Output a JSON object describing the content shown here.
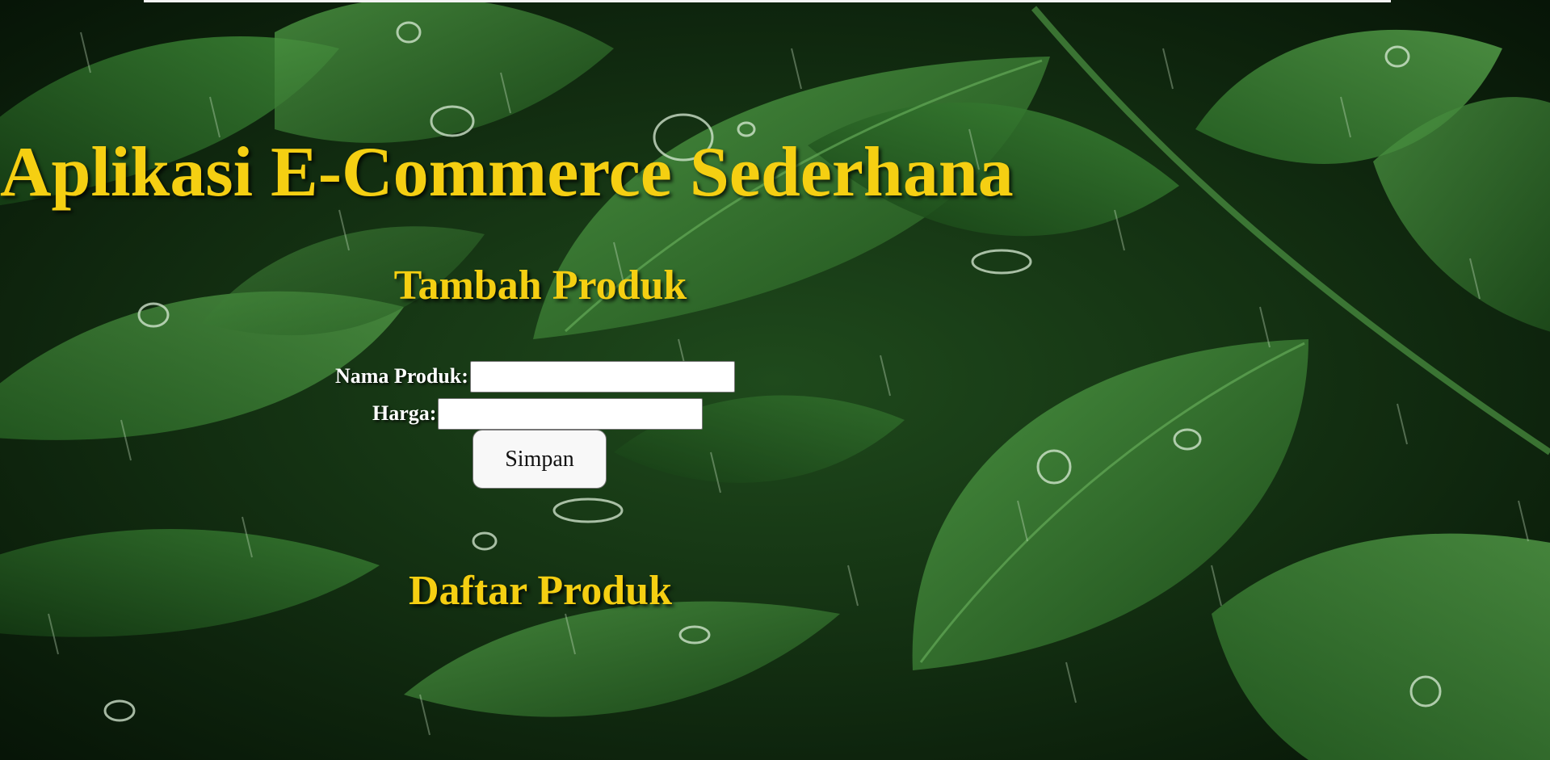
{
  "colors": {
    "heading": "#f5cf12",
    "label": "#ffffff",
    "background_dark": "#0f2a10",
    "leaf_green": "#2f7a2c"
  },
  "background": {
    "icon": "rainy-leaves-image"
  },
  "app": {
    "title": "Aplikasi E-Commerce Sederhana"
  },
  "add_product": {
    "title": "Tambah Produk",
    "name_label": "Nama Produk:",
    "name_value": "",
    "price_label": "Harga:",
    "price_value": "",
    "save_label": "Simpan"
  },
  "product_list": {
    "title": "Daftar Produk"
  }
}
